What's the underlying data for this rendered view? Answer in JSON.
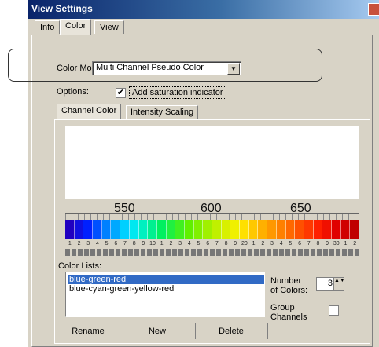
{
  "window": {
    "title": "View Settings"
  },
  "tabs": [
    {
      "label": "Info"
    },
    {
      "label": "Color"
    },
    {
      "label": "View"
    }
  ],
  "color_mode": {
    "label": "Color Mode:",
    "value": "Multi Channel Pseudo Color"
  },
  "options": {
    "label": "Options:",
    "checkbox_label": "Add saturation indicator",
    "checked": true,
    "check_mark": "✔"
  },
  "subtabs": [
    {
      "label": "Channel Color"
    },
    {
      "label": "Intensity Scaling"
    }
  ],
  "spectrum": {
    "axis_ticks": [
      "550",
      "600",
      "650"
    ],
    "channel_numbers": [
      "1",
      "2",
      "3",
      "4",
      "5",
      "6",
      "7",
      "8",
      "9",
      "10",
      "1",
      "2",
      "3",
      "4",
      "5",
      "6",
      "7",
      "8",
      "9",
      "20",
      "1",
      "2",
      "3",
      "4",
      "5",
      "6",
      "7",
      "8",
      "9",
      "30",
      "1",
      "2"
    ],
    "colors": [
      "#2000c0",
      "#1010e0",
      "#0020ff",
      "#0050ff",
      "#0080ff",
      "#00a8ff",
      "#00d0ff",
      "#00e8f0",
      "#00f0c0",
      "#00f090",
      "#00f060",
      "#20f040",
      "#40f020",
      "#60f000",
      "#80f000",
      "#a0f000",
      "#c0f000",
      "#d8f000",
      "#f0f000",
      "#ffe000",
      "#ffc800",
      "#ffb000",
      "#ff9800",
      "#ff8000",
      "#ff6800",
      "#ff5000",
      "#ff3800",
      "#ff2000",
      "#f01000",
      "#e00000",
      "#d00000",
      "#c00000"
    ]
  },
  "color_lists": {
    "label": "Color Lists:",
    "items": [
      {
        "label": "blue-green-red",
        "selected": true
      },
      {
        "label": "blue-cyan-green-yellow-red",
        "selected": false
      }
    ]
  },
  "number_of_colors": {
    "label_line1": "Number",
    "label_line2": "of Colors:",
    "value": "3",
    "spin_arrows": "▲▼"
  },
  "group_channels": {
    "label_line1": "Group",
    "label_line2": "Channels",
    "checked": false
  },
  "dropdown_arrow": "▼",
  "buttons": {
    "rename": "Rename",
    "new": "New",
    "delete": "Delete"
  }
}
